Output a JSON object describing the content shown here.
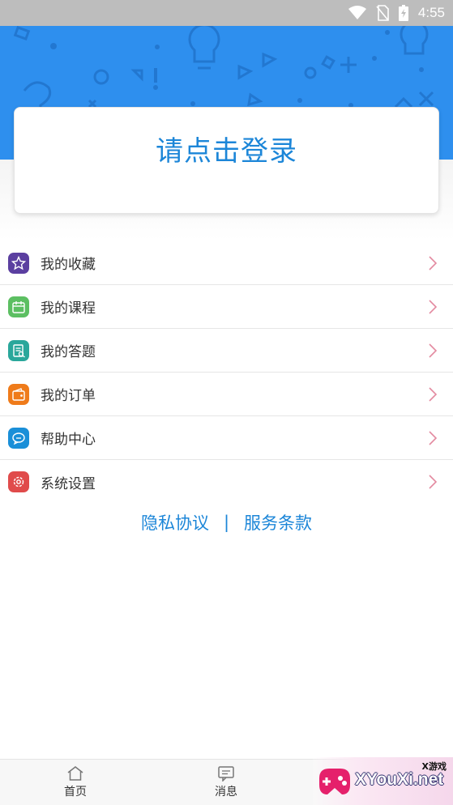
{
  "status_bar": {
    "time": "4:55"
  },
  "login": {
    "prompt": "请点击登录"
  },
  "menu": [
    {
      "label": "我的收藏",
      "icon": "star-icon",
      "color": "#5b3fa0"
    },
    {
      "label": "我的课程",
      "icon": "calendar-icon",
      "color": "#5cbf62"
    },
    {
      "label": "我的答题",
      "icon": "quiz-icon",
      "color": "#2aa79b"
    },
    {
      "label": "我的订单",
      "icon": "wallet-icon",
      "color": "#ef7b1a"
    },
    {
      "label": "帮助中心",
      "icon": "chat-icon",
      "color": "#1a8fd8"
    },
    {
      "label": "系统设置",
      "icon": "gear-icon",
      "color": "#e04b4b"
    }
  ],
  "links": {
    "privacy": "隐私协议",
    "separator": "|",
    "terms": "服务条款"
  },
  "bottom_nav": [
    {
      "label": "首页",
      "icon": "home-icon"
    },
    {
      "label": "消息",
      "icon": "message-icon"
    }
  ],
  "watermark": {
    "site": "XYouXi.net",
    "small": "X游戏"
  },
  "colors": {
    "primary": "#2e8fee",
    "link": "#1c86d8",
    "chevron": "#e38aa0"
  }
}
